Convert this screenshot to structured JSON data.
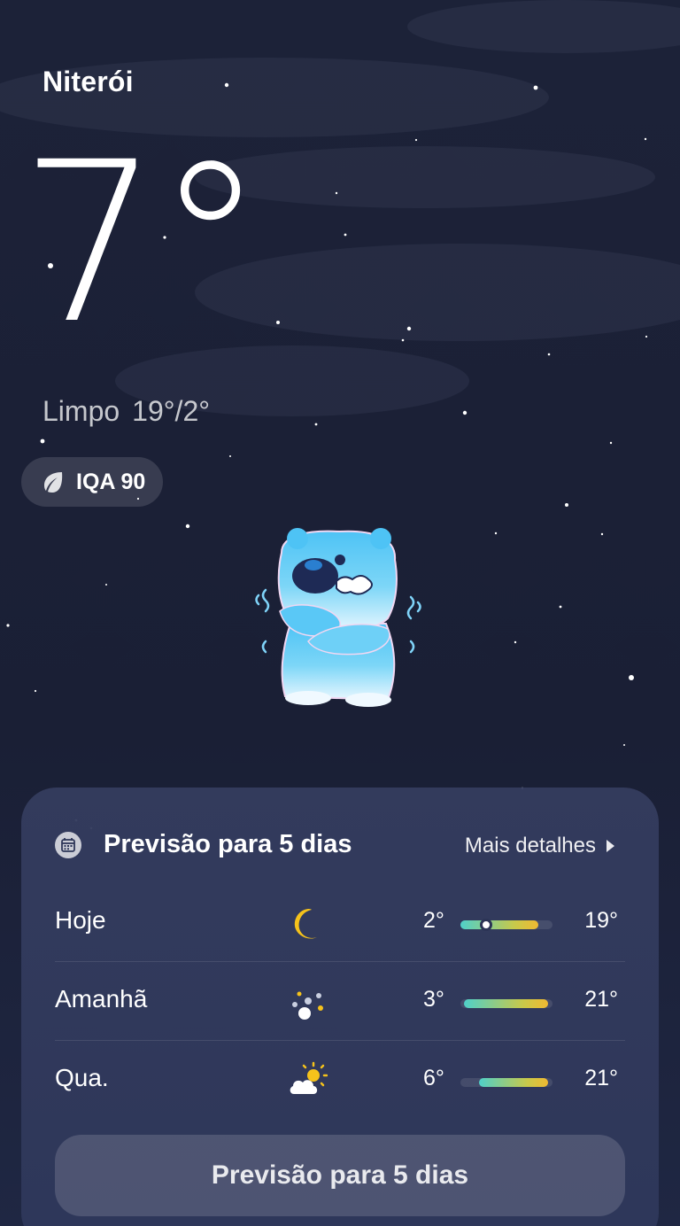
{
  "location": {
    "city": "Niterói"
  },
  "current": {
    "temperature": "7°",
    "condition": "Limpo",
    "high_low": "19°/2°",
    "aqi_label": "IQA 90",
    "aqi_icon": "leaf-icon"
  },
  "forecast": {
    "title": "Previsão para 5 dias",
    "more_label": "Mais detalhes",
    "days": [
      {
        "day": "Hoje",
        "icon": "moon-icon",
        "low": "2°",
        "high": "19°",
        "range_start": 0.0,
        "range_end": 0.85,
        "current_marker": 0.28
      },
      {
        "day": "Amanhã",
        "icon": "scattered-weather-icon",
        "low": "3°",
        "high": "21°",
        "range_start": 0.04,
        "range_end": 0.95
      },
      {
        "day": "Qua.",
        "icon": "partly-cloudy-icon",
        "low": "6°",
        "high": "21°",
        "range_start": 0.2,
        "range_end": 0.95
      }
    ],
    "button_label": "Previsão para 5 dias"
  },
  "colors": {
    "background": "#1c2238",
    "card": "#343c5e",
    "range_start": "#4fd0c9",
    "range_end": "#f0b931",
    "moon": "#f5c21b"
  }
}
